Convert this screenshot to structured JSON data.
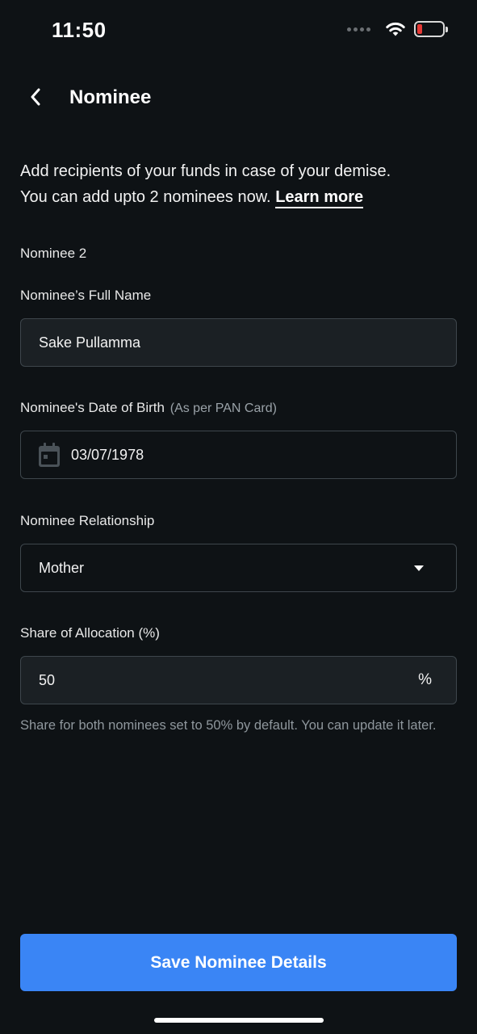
{
  "status_bar": {
    "time": "11:50"
  },
  "header": {
    "title": "Nominee"
  },
  "intro": {
    "line1": "Add recipients of your funds in case of your demise.",
    "line2": "You can add upto 2 nominees now.",
    "learn_more": "Learn more"
  },
  "section_label": "Nominee 2",
  "fields": {
    "full_name": {
      "label": "Nominee’s Full Name",
      "value": "Sake Pullamma"
    },
    "dob": {
      "label": "Nominee's Date of Birth",
      "hint": "(As per PAN Card)",
      "value": "03/07/1978"
    },
    "relationship": {
      "label": "Nominee Relationship",
      "value": "Mother"
    },
    "share": {
      "label": "Share of Allocation (%)",
      "value": "50",
      "suffix": "%"
    }
  },
  "helper_text": "Share for both nominees set to 50% by default. You can update it later.",
  "save_button": {
    "label": "Save Nominee Details"
  },
  "colors": {
    "background": "#0e1215",
    "accent": "#3a85f5",
    "field_border": "#3e464c",
    "battery_low": "#e53935"
  },
  "icons": {
    "back": "chevron-left-icon",
    "calendar": "calendar-icon",
    "dropdown": "caret-down-icon",
    "wifi": "wifi-icon",
    "battery": "battery-icon"
  }
}
